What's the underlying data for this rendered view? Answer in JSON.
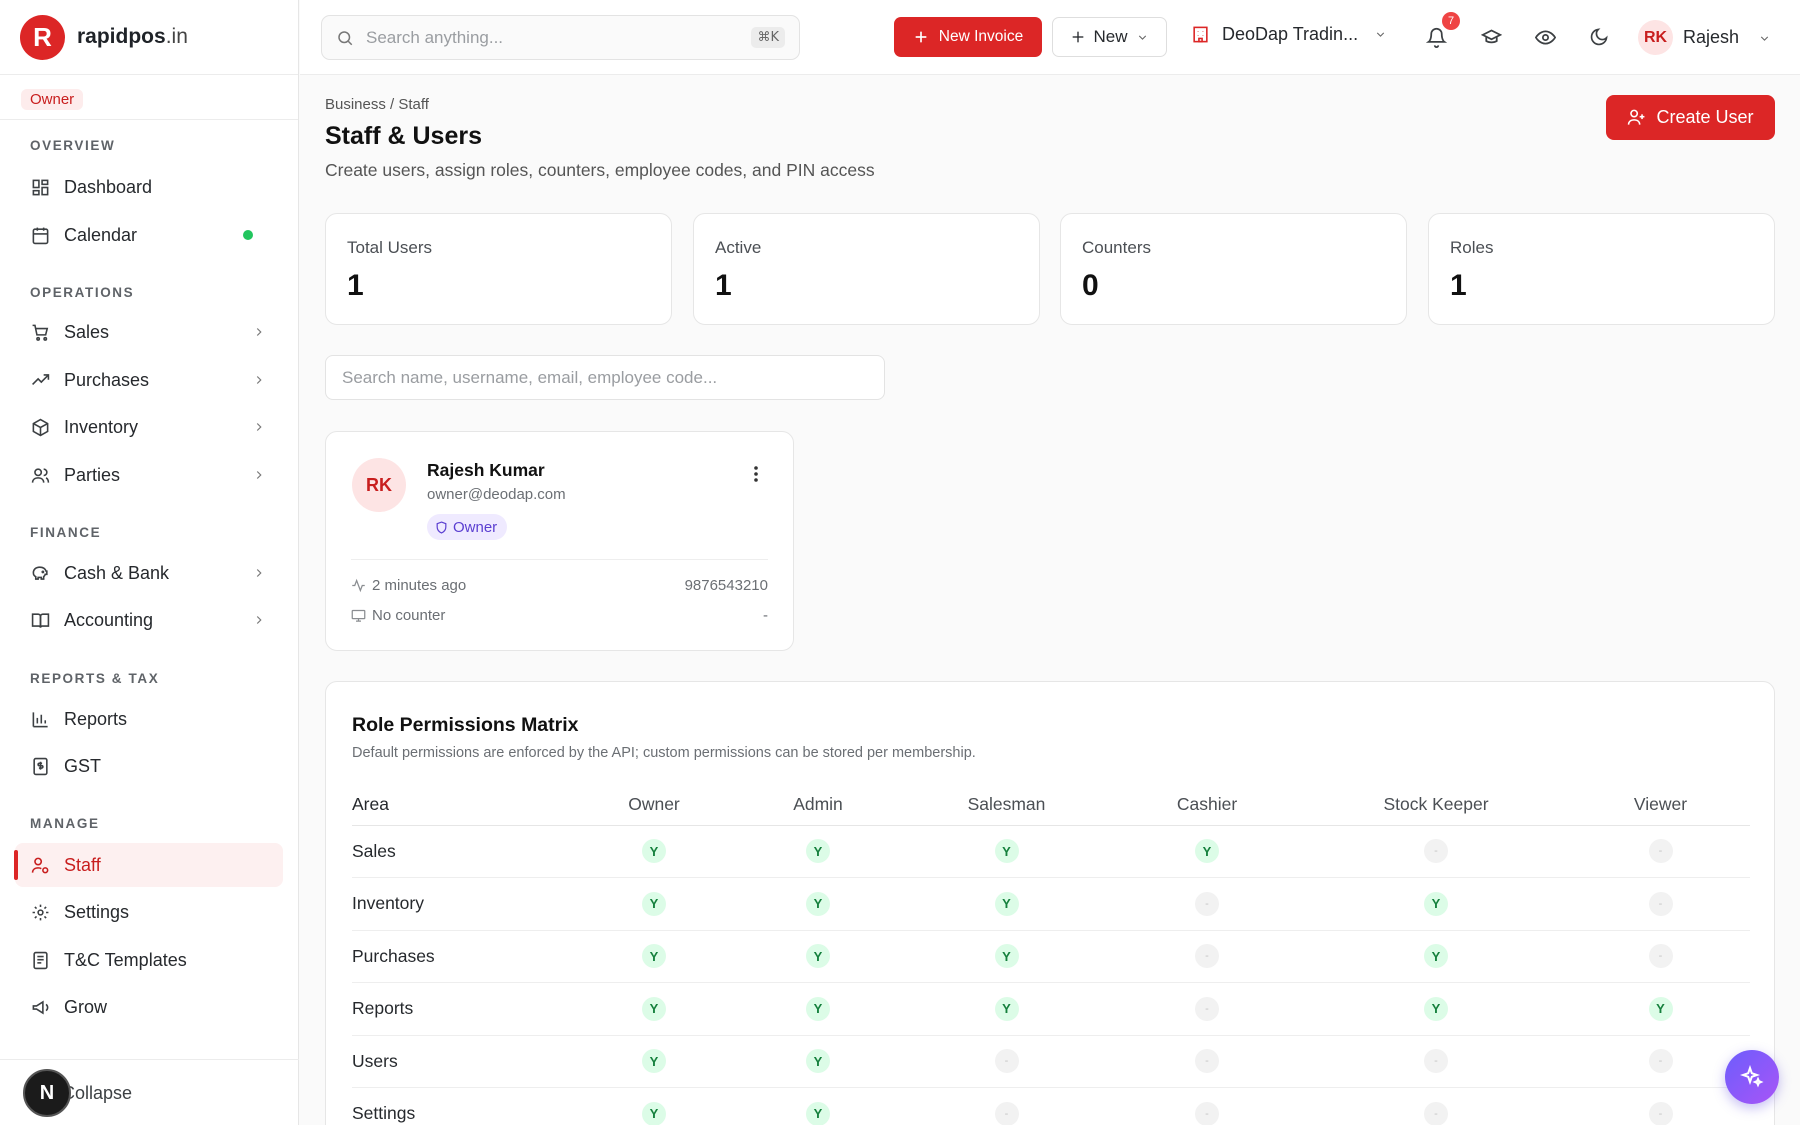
{
  "brand": {
    "name": "rapidpos",
    "tld": ".in",
    "mark": "R"
  },
  "role_badge": "Owner",
  "sidebar": {
    "sections": {
      "overview": "OVERVIEW",
      "operations": "OPERATIONS",
      "finance": "FINANCE",
      "reports_tax": "REPORTS & TAX",
      "manage": "MANAGE"
    },
    "items": {
      "dashboard": "Dashboard",
      "calendar": "Calendar",
      "sales": "Sales",
      "purchases": "Purchases",
      "inventory": "Inventory",
      "parties": "Parties",
      "cash_bank": "Cash & Bank",
      "accounting": "Accounting",
      "reports": "Reports",
      "gst": "GST",
      "staff": "Staff",
      "settings": "Settings",
      "tc_templates": "T&C Templates",
      "grow": "Grow"
    },
    "active_item": "Staff",
    "collapse_label": "Collapse",
    "n_badge": "N"
  },
  "topbar": {
    "search_placeholder": "Search anything...",
    "shortcut": "⌘K",
    "new_invoice": "New Invoice",
    "new": "New",
    "company": "DeoDap Tradin...",
    "notification_count": "7",
    "user_initials": "RK",
    "user_name": "Rajesh"
  },
  "page": {
    "breadcrumb": "Business / Staff",
    "title": "Staff & Users",
    "subtitle": "Create users, assign roles, counters, employee codes, and PIN access",
    "create_user": "Create User"
  },
  "stats": [
    {
      "label": "Total Users",
      "value": "1"
    },
    {
      "label": "Active",
      "value": "1"
    },
    {
      "label": "Counters",
      "value": "0"
    },
    {
      "label": "Roles",
      "value": "1"
    }
  ],
  "user_search_placeholder": "Search name, username, email, employee code...",
  "user_card": {
    "initials": "RK",
    "name": "Rajesh Kumar",
    "email": "owner@deodap.com",
    "role": "Owner",
    "last_active": "2 minutes ago",
    "phone": "9876543210",
    "counter": "No counter",
    "employee_code": "-"
  },
  "matrix": {
    "title": "Role Permissions Matrix",
    "subtitle": "Default permissions are enforced by the API; custom permissions can be stored per membership.",
    "columns": [
      "Area",
      "Owner",
      "Admin",
      "Salesman",
      "Cashier",
      "Stock Keeper",
      "Viewer"
    ],
    "rows": [
      {
        "area": "Sales",
        "cells": [
          "Y",
          "Y",
          "Y",
          "Y",
          "-",
          "-"
        ]
      },
      {
        "area": "Inventory",
        "cells": [
          "Y",
          "Y",
          "Y",
          "-",
          "Y",
          "-"
        ]
      },
      {
        "area": "Purchases",
        "cells": [
          "Y",
          "Y",
          "Y",
          "-",
          "Y",
          "-"
        ]
      },
      {
        "area": "Reports",
        "cells": [
          "Y",
          "Y",
          "Y",
          "-",
          "Y",
          "Y"
        ]
      },
      {
        "area": "Users",
        "cells": [
          "Y",
          "Y",
          "-",
          "-",
          "-",
          "-"
        ]
      },
      {
        "area": "Settings",
        "cells": [
          "Y",
          "Y",
          "-",
          "-",
          "-",
          "-"
        ]
      }
    ]
  },
  "colors": {
    "accent": "#dc2626",
    "accent_soft": "#fdf0f0",
    "success": "#15803d",
    "success_soft": "#dcfce7",
    "role_purple": "#5b3fd1"
  },
  "icons": {
    "search": "search-icon",
    "plus": "plus-icon",
    "building": "building-icon",
    "bell": "bell-icon",
    "graduation": "graduation-cap-icon",
    "eye": "eye-icon",
    "moon": "moon-icon",
    "more": "more-vertical-icon",
    "shield": "shield-icon",
    "activity": "activity-icon",
    "monitor": "monitor-icon",
    "sparkles": "sparkles-icon"
  }
}
